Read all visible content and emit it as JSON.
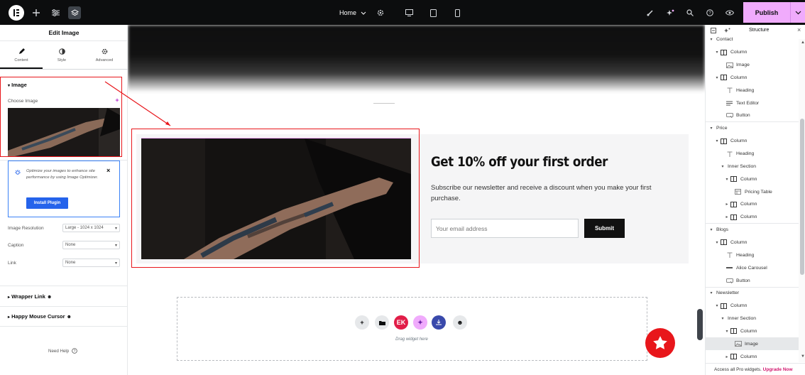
{
  "topbar": {
    "page_selector": "Home",
    "publish_label": "Publish",
    "icons": [
      "elementor-logo-icon",
      "add-icon",
      "settings-sliders-icon",
      "structure-layers-icon",
      "gear-icon",
      "desktop-icon",
      "tablet-icon",
      "mobile-icon",
      "brush-icon",
      "sparkle-icon",
      "search-icon",
      "help-icon",
      "eye-icon",
      "chevron-down-icon"
    ]
  },
  "left_panel": {
    "title": "Edit Image",
    "tabs": [
      {
        "label": "Content",
        "icon": "pencil-icon"
      },
      {
        "label": "Style",
        "icon": "half-circle-icon"
      },
      {
        "label": "Advanced",
        "icon": "gear-icon"
      }
    ],
    "image_section": {
      "heading": "Image",
      "choose_label": "Choose Image"
    },
    "notice": {
      "text": "Optimize your images to enhance site performance by using Image Optimizer.",
      "button": "Install Plugin"
    },
    "fields": [
      {
        "label": "Image Resolution",
        "value": "Large - 1024 x 1024"
      },
      {
        "label": "Caption",
        "value": "None"
      },
      {
        "label": "Link",
        "value": "None"
      }
    ],
    "collapsed_sections": [
      "Wrapper Link",
      "Happy Mouse Cursor"
    ],
    "need_help": "Need Help"
  },
  "canvas": {
    "promo": {
      "title": "Get 10% off your first order",
      "text": "Subscribe our newsletter and receive a discount when you make your first purchase.",
      "email_placeholder": "Your email address",
      "submit": "Submit"
    },
    "drop_zone_text": "Drag widget here"
  },
  "right_panel": {
    "title": "Structure",
    "tree": [
      {
        "label": "Contact",
        "level": 0,
        "caret": "down",
        "icon": "none"
      },
      {
        "label": "Column",
        "level": 1,
        "caret": "down",
        "icon": "column-icon"
      },
      {
        "label": "Image",
        "level": 2,
        "caret": "",
        "icon": "image-icon"
      },
      {
        "label": "Column",
        "level": 1,
        "caret": "down",
        "icon": "column-icon"
      },
      {
        "label": "Heading",
        "level": 2,
        "caret": "",
        "icon": "heading-icon"
      },
      {
        "label": "Text Editor",
        "level": 2,
        "caret": "",
        "icon": "text-editor-icon"
      },
      {
        "label": "Button",
        "level": 2,
        "caret": "",
        "icon": "button-icon"
      },
      {
        "label": "Price",
        "level": 0,
        "caret": "down",
        "icon": "none"
      },
      {
        "label": "Column",
        "level": 1,
        "caret": "down",
        "icon": "column-icon"
      },
      {
        "label": "Heading",
        "level": 2,
        "caret": "",
        "icon": "heading-icon"
      },
      {
        "label": "Inner Section",
        "level": 2,
        "caret": "down",
        "icon": "none"
      },
      {
        "label": "Column",
        "level": 3,
        "caret": "down",
        "icon": "column-icon"
      },
      {
        "label": "Pricing Table",
        "level": 4,
        "caret": "",
        "icon": "pricing-table-icon"
      },
      {
        "label": "Column",
        "level": 3,
        "caret": "right",
        "icon": "column-icon"
      },
      {
        "label": "Column",
        "level": 3,
        "caret": "right",
        "icon": "column-icon"
      },
      {
        "label": "Blogs",
        "level": 0,
        "caret": "down",
        "icon": "none"
      },
      {
        "label": "Column",
        "level": 1,
        "caret": "down",
        "icon": "column-icon"
      },
      {
        "label": "Heading",
        "level": 2,
        "caret": "",
        "icon": "heading-icon"
      },
      {
        "label": "Alice Carousel",
        "level": 2,
        "caret": "",
        "icon": "carousel-icon"
      },
      {
        "label": "Button",
        "level": 2,
        "caret": "",
        "icon": "button-icon"
      },
      {
        "label": "Newsletter",
        "level": 0,
        "caret": "down",
        "icon": "none"
      },
      {
        "label": "Column",
        "level": 1,
        "caret": "down",
        "icon": "column-icon"
      },
      {
        "label": "Inner Section",
        "level": 2,
        "caret": "down",
        "icon": "none"
      },
      {
        "label": "Column",
        "level": 3,
        "caret": "down",
        "icon": "column-icon"
      },
      {
        "label": "Image",
        "level": 4,
        "caret": "",
        "icon": "image-icon",
        "selected": true
      },
      {
        "label": "Column",
        "level": 3,
        "caret": "right",
        "icon": "column-icon"
      }
    ],
    "pro_text": "Access all Pro widgets.",
    "pro_link": "Upgrade Now"
  },
  "colors": {
    "topbar_bg": "#0c0d0e",
    "publish_bg": "#f0abfc",
    "highlight_red": "#e8161b",
    "install_button": "#2563eb",
    "pro_link": "#d1186f"
  }
}
